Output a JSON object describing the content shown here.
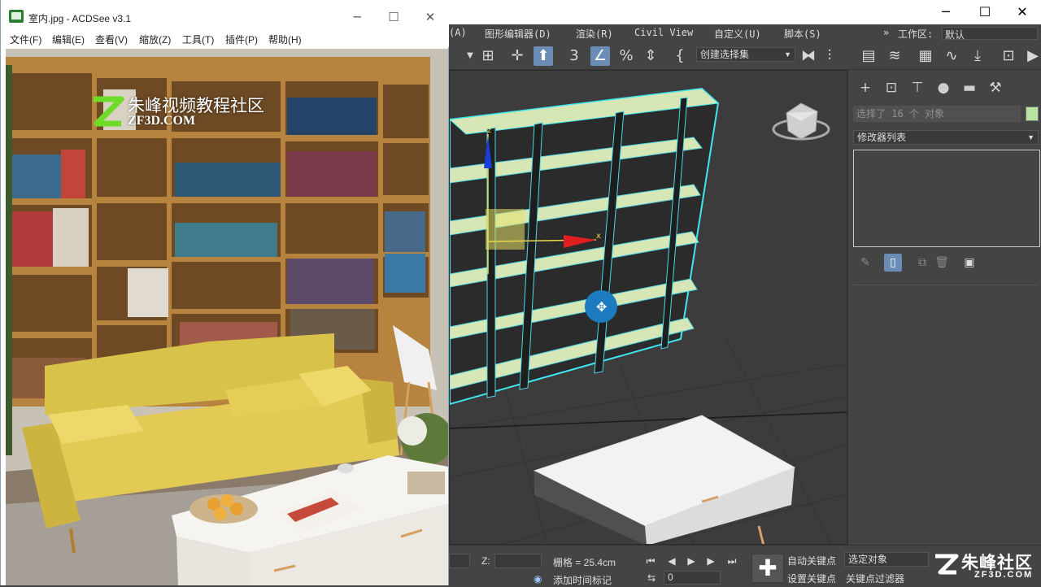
{
  "acdsee": {
    "title": "室内.jpg - ACDSee v3.1",
    "menu": [
      "文件(F)",
      "编辑(E)",
      "查看(V)",
      "缩放(Z)",
      "工具(T)",
      "插件(P)",
      "帮助(H)"
    ],
    "image_watermark": {
      "title": "朱峰视频教程社区",
      "sub": "ZF3D.COM"
    }
  },
  "max": {
    "menu": [
      "(A)",
      "图形编辑器(D)",
      "渲染(R)",
      "Civil View",
      "自定义(U)",
      "脚本(S)"
    ],
    "workspace_label": "工作区:",
    "workspace_value": "默认",
    "selection_set": "创建选择集",
    "command_panel": {
      "selection_count": "选择了 16 个 对象",
      "modifier_list": "修改器列表",
      "color": "#b9e3a3"
    },
    "viewport": {
      "axis_z": "z",
      "axis_x": "x"
    },
    "bottom": {
      "z_label": "Z:",
      "grid": "栅格 = 25.4cm",
      "add_time_tag": "添加时间标记",
      "frame": "0",
      "auto_key": "自动关键点",
      "set_key": "设置关键点",
      "selected_object": "选定对象",
      "key_filters": "关键点过滤器"
    },
    "watermark": {
      "big": "朱峰社区",
      "small": "ZF3D.COM"
    }
  },
  "colors": {
    "max_bg": "#444444",
    "selection_cyan": "#3fe6f0",
    "shelf_face": "#d7e6b5",
    "active_blue": "#6b8db5"
  }
}
